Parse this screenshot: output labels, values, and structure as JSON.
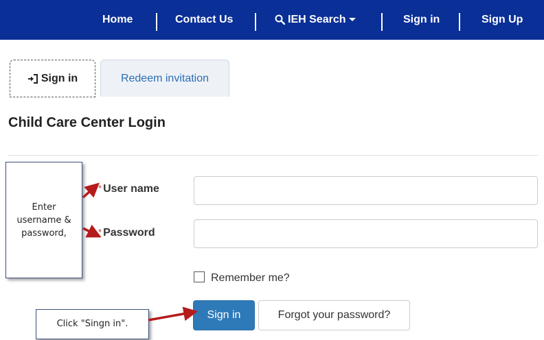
{
  "nav": {
    "home": "Home",
    "contact": "Contact Us",
    "search": "IEH Search",
    "signin": "Sign in",
    "signup": "Sign Up"
  },
  "tabs": {
    "signin": "Sign in",
    "redeem": "Redeem invitation"
  },
  "page_title": "Child Care Center Login",
  "form": {
    "required_mark": "*",
    "username_label": "User name",
    "username_value": "",
    "password_label": "Password",
    "password_value": "",
    "remember_label": "Remember me?",
    "remember_checked": false,
    "signin_button": "Sign in",
    "forgot_button": "Forgot your password?"
  },
  "annotations": {
    "callout_1_lines": [
      "Enter",
      "username &",
      "password,"
    ],
    "callout_2": "Click \"Singn in\"."
  },
  "colors": {
    "navbar": "#0a2f97",
    "primary_button": "#2e7ab8",
    "arrow": "#b51c1c",
    "required": "#cc3333",
    "link": "#2a6db5"
  },
  "icons": {
    "search": "search-icon",
    "caret": "caret-down-icon",
    "signin": "sign-in-icon"
  }
}
